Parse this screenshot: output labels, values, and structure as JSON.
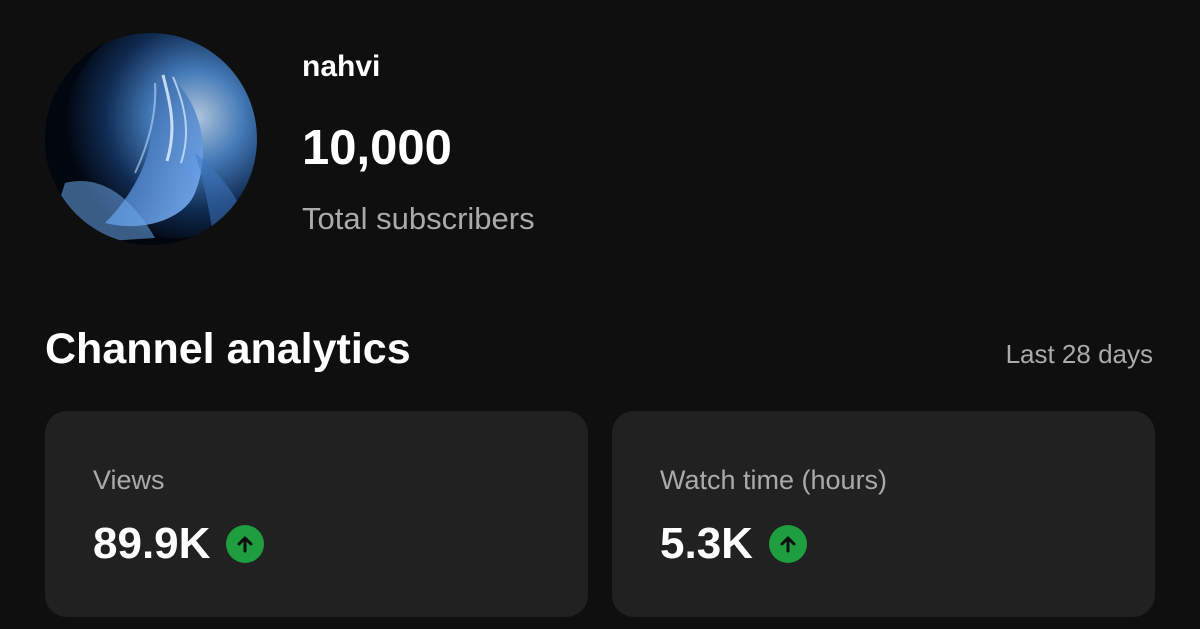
{
  "channel": {
    "name": "nahvi",
    "subscriber_count": "10,000",
    "subscriber_caption": "Total subscribers",
    "avatar_icon": "profile-photo"
  },
  "analytics": {
    "title": "Channel analytics",
    "period": "Last 28 days",
    "cards": [
      {
        "label": "Views",
        "value": "89.9K",
        "trend": "up",
        "trend_icon": "arrow-up-icon",
        "trend_color": "#1e9e3e"
      },
      {
        "label": "Watch time (hours)",
        "value": "5.3K",
        "trend": "up",
        "trend_icon": "arrow-up-icon",
        "trend_color": "#1e9e3e"
      }
    ]
  },
  "colors": {
    "background": "#0f0f0f",
    "card_background": "#212121",
    "primary_text": "#ffffff",
    "secondary_text": "#aaaaaa",
    "trend_up": "#1e9e3e"
  }
}
